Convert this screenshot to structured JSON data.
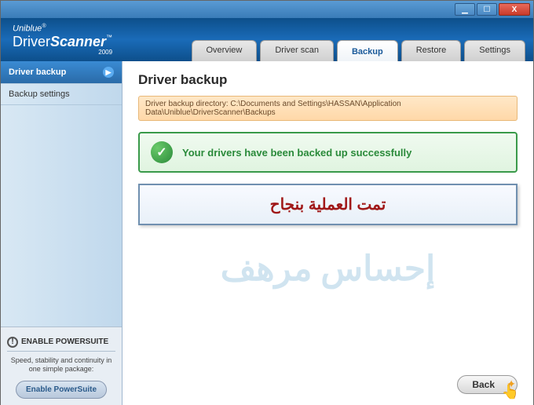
{
  "brand": {
    "company": "Uniblue",
    "product_a": "Driver",
    "product_b": "Scanner",
    "year": "2009",
    "reg": "®",
    "tm": "™"
  },
  "window_controls": {
    "min": "▁",
    "max": "☐",
    "close": "X"
  },
  "tabs": {
    "overview": "Overview",
    "driverscan": "Driver scan",
    "backup": "Backup",
    "restore": "Restore",
    "settings": "Settings"
  },
  "sidebar": {
    "items": [
      {
        "label": "Driver backup"
      },
      {
        "label": "Backup settings"
      }
    ]
  },
  "powersuite": {
    "title": "ENABLE POWERSUITE",
    "desc": "Speed, stability and continuity in one simple package:",
    "button": "Enable PowerSuite"
  },
  "main": {
    "title": "Driver backup",
    "dir_label": "Driver backup directory: C:\\Documents and Settings\\HASSAN\\Application Data\\Uniblue\\DriverScanner\\Backups",
    "success": "Your drivers have been backed up successfully",
    "arabic_msg": "تمت العملية بنجاح",
    "watermark": "إحساس مرهف",
    "back": "Back"
  }
}
